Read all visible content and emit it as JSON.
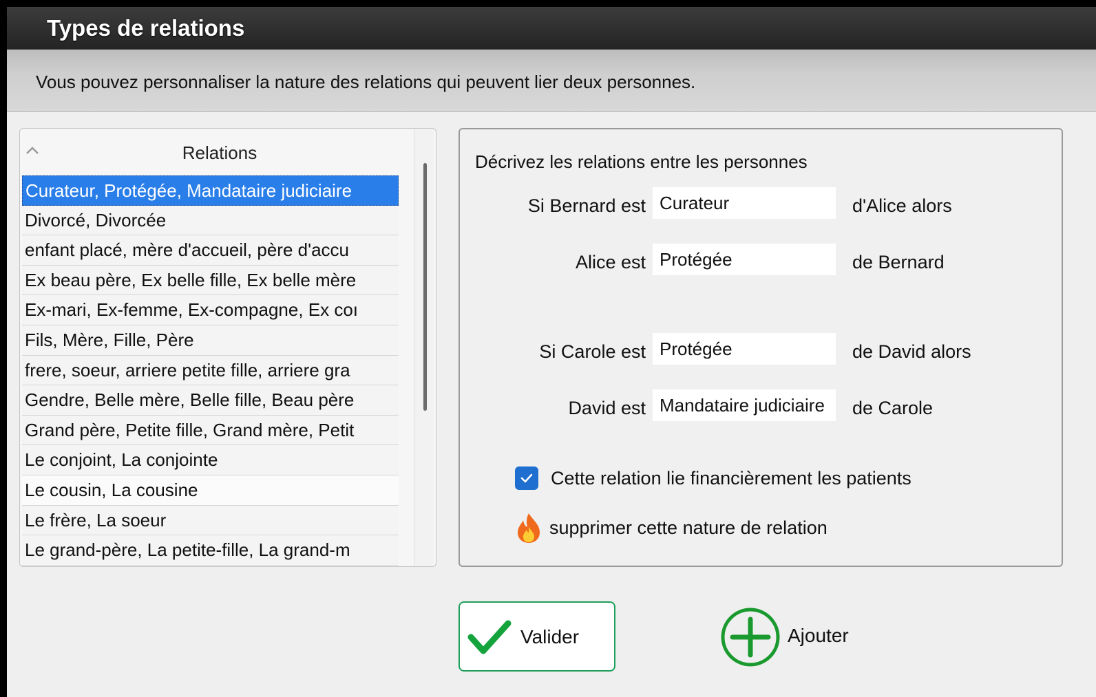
{
  "window": {
    "title": "Types de relations",
    "description": "Vous pouvez personnaliser la nature des relations qui peuvent lier deux personnes."
  },
  "list": {
    "header": "Relations",
    "rows": [
      "Curateur, Protégée, Mandataire judiciaire",
      "Divorcé, Divorcée",
      "enfant placé, mère d'accueil, père d'accu",
      "Ex beau père, Ex belle fille, Ex belle mère",
      "Ex-mari, Ex-femme, Ex-compagne, Ex coı",
      "Fils, Mère, Fille, Père",
      "frere, soeur, arriere petite fille, arriere gra",
      "Gendre, Belle mère, Belle fille, Beau père",
      "Grand père, Petite fille, Grand mère, Petit",
      "Le conjoint, La conjointe",
      "Le cousin, La cousine",
      "Le frère, La soeur",
      "Le grand-père, La petite-fille, La grand-m"
    ]
  },
  "details": {
    "heading": "Décrivez les relations entre les personnes",
    "fields": [
      {
        "label": "Si Bernard est",
        "value": "Curateur",
        "suffix": "d'Alice alors"
      },
      {
        "label": "Alice est",
        "value": "Protégée",
        "suffix": "de Bernard"
      },
      {
        "label": "Si Carole est",
        "value": "Protégée",
        "suffix": "de David alors"
      },
      {
        "label": "David est",
        "value": "Mandataire judiciaire",
        "suffix": "de Carole"
      }
    ],
    "checkbox_label": "Cette relation lie financièrement les patients",
    "checkbox_checked": true,
    "delete_label": "supprimer cette nature de relation"
  },
  "buttons": {
    "valider": "Valider",
    "ajouter": "Ajouter"
  },
  "colors": {
    "selection": "#2a7ee9",
    "checkbox": "#1f6fd1",
    "valider_check": "#14a33c",
    "ajouter_plus": "#1a9a2e"
  }
}
